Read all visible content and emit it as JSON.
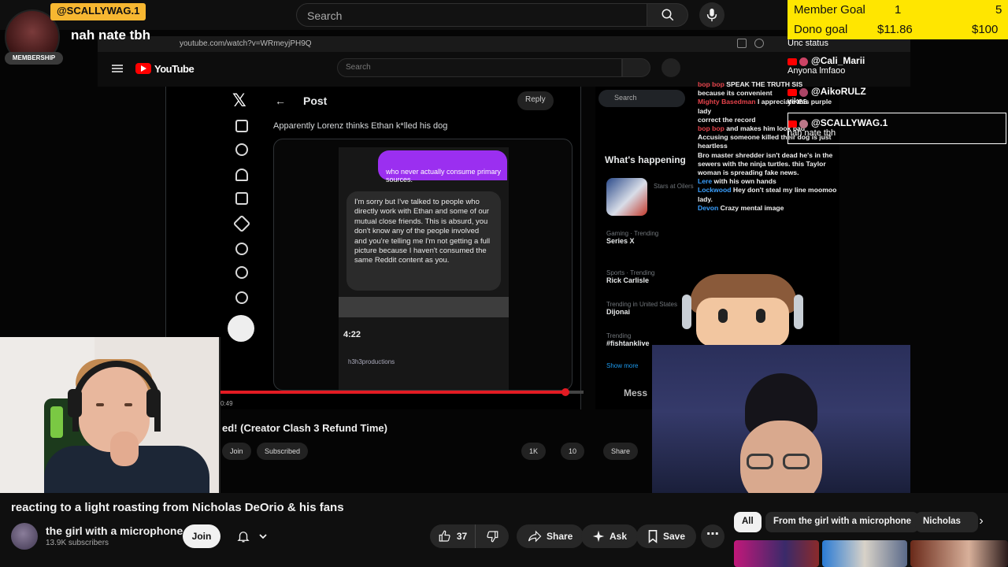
{
  "topbar": {
    "search_placeholder": "Search"
  },
  "inner_browser": {
    "url": "youtube.com/watch?v=WRmeyjPH9Q",
    "yt_logo": "YouTube",
    "search_placeholder": "Search"
  },
  "x_post": {
    "header": "Post",
    "reply": "Reply",
    "caption": "Apparently Lorenz thinks Ethan k*lled his dog",
    "purple_bubble": "who never actually consume primary sources.",
    "gray_bubble": "I'm sorry but I've talked to people who directly work with Ethan and some of our mutual close friends. This is absurd, you don't know any of the people involved and you're telling me I'm not getting a full picture because I haven't consumed the same Reddit content as you.",
    "phone_time": "4:22",
    "phone_user": "h3h3productions",
    "progress": 0.95
  },
  "x_right": {
    "search": "Search",
    "whats_happening": "What's happening",
    "trends": [
      {
        "meta": "Stars at Oilers",
        "title": ""
      },
      {
        "meta": "Gaming · Trending",
        "title": "Series X"
      },
      {
        "meta": "Sports · Trending",
        "title": "Rick Carlisle"
      },
      {
        "meta": "Trending in United States",
        "title": "Dijonai"
      },
      {
        "meta": "Trending",
        "title": "#fishtanklive"
      }
    ],
    "show_more": "Show more"
  },
  "stream_chat": [
    {
      "name": "bop bop",
      "text": "SPEAK THE TRUTH SIS"
    },
    {
      "name": "",
      "text": "because its convenient"
    },
    {
      "name": "Mighty Basedman",
      "text": "I appreciate this purple lady"
    },
    {
      "name": "",
      "text": "correct the record"
    },
    {
      "name": "bop bop",
      "text": "and makes him look bad"
    },
    {
      "name": "",
      "text": "Accusing someone killed their dog is just heartless"
    },
    {
      "name": "",
      "text": "Bro master shredder isn't dead he's in the sewers with the ninja turtles. this Taylor woman is spreading fake news."
    },
    {
      "name": "Lere",
      "text": "with his own hands"
    },
    {
      "name": "Lockwood",
      "text": "Hey don't steal my line moomoo lady."
    },
    {
      "name": "Devon",
      "text": "Crazy mental image"
    }
  ],
  "overlay": {
    "video_title_partial": "ed! (Creator Clash 3 Refund Time)",
    "join": "Join",
    "subscribed": "Subscribed",
    "likes": "1K",
    "dislikes": "10",
    "share": "Share",
    "mess": "Mess",
    "time": "0:49"
  },
  "stream_alert": {
    "username": "@SCALLYWAG.1",
    "message": "nah nate tbh",
    "badge": "MEMBERSHIP"
  },
  "goals": {
    "member_label": "Member Goal",
    "member_current": "1",
    "member_target": "5",
    "dono_label": "Dono goal",
    "dono_current": "$11.86",
    "dono_target": "$100"
  },
  "chat": {
    "status": "Unc status",
    "messages": [
      {
        "user": "@Cali_Marii",
        "text": "Anyona lmfaoo"
      },
      {
        "user": "@AikoRULZ",
        "text": "yikes"
      },
      {
        "user": "@SCALLYWAG.1",
        "text": "nah nate tbh"
      }
    ]
  },
  "video": {
    "title": "reacting to a light roasting from Nicholas DeOrio & his fans",
    "channel": "the girl with a microphone",
    "subscribers": "13.9K subscribers",
    "join": "Join",
    "likes": "37",
    "share": "Share",
    "ask": "Ask",
    "save": "Save"
  },
  "chips": [
    {
      "label": "All",
      "active": true
    },
    {
      "label": "From the girl with a microphone",
      "active": false
    },
    {
      "label": "Nicholas",
      "active": false
    }
  ],
  "colors": {
    "background": "#0f0f0f",
    "youtube_red": "#ff0000",
    "goal_yellow": "#ffe600",
    "alert_gold": "#f7b731"
  }
}
